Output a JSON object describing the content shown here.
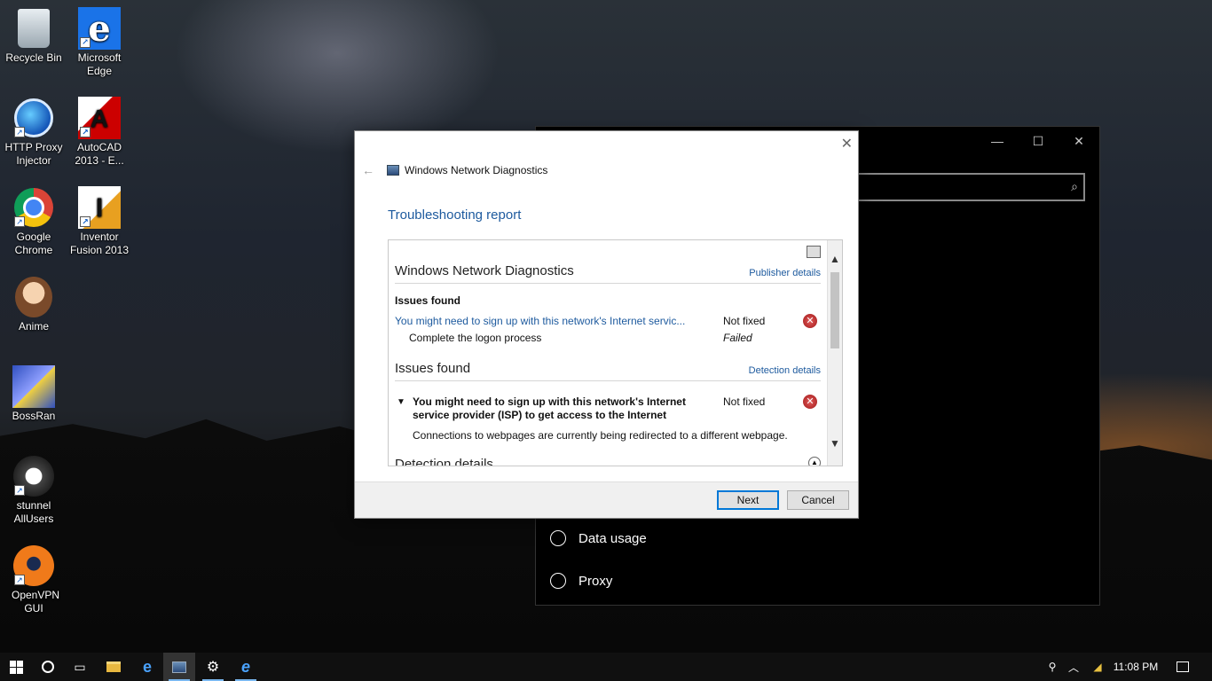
{
  "desktop": {
    "icons": [
      {
        "label": "Recycle Bin",
        "icon": "recycle-bin-icon"
      },
      {
        "label": "Microsoft Edge",
        "icon": "edge-icon"
      },
      {
        "label": "HTTP Proxy Injector",
        "icon": "http-proxy-injector-icon"
      },
      {
        "label": "AutoCAD 2013 - E...",
        "icon": "autocad-icon"
      },
      {
        "label": "Google Chrome",
        "icon": "chrome-icon"
      },
      {
        "label": "Inventor Fusion 2013",
        "icon": "inventor-icon"
      },
      {
        "label": "Anime",
        "icon": "anime-icon"
      },
      {
        "label": "BossRan",
        "icon": "bossran-icon"
      },
      {
        "label": "stunnel AllUsers",
        "icon": "stunnel-icon"
      },
      {
        "label": "OpenVPN GUI",
        "icon": "openvpn-icon"
      }
    ]
  },
  "settings_window": {
    "controls": {
      "minimize": "—",
      "maximize": "☐",
      "close": "✕"
    },
    "items": [
      {
        "label": "Data usage",
        "icon": "data-usage-icon"
      },
      {
        "label": "Proxy",
        "icon": "globe-icon"
      }
    ]
  },
  "dialog": {
    "title": "Windows Network Diagnostics",
    "heading": "Troubleshooting report",
    "report": {
      "section1_title": "Windows Network Diagnostics",
      "publisher_link": "Publisher details",
      "issues_found_label": "Issues found",
      "issue1_link": "You might need to sign up with this network's Internet servic...",
      "issue1_status": "Not fixed",
      "issue1_sub": "Complete the logon process",
      "issue1_sub_status": "Failed",
      "section2_title": "Issues found",
      "detection_link": "Detection details",
      "issue2_title": "You might need to sign up with this network's Internet service provider (ISP) to get access to the Internet",
      "issue2_status": "Not fixed",
      "issue2_desc": "Connections to webpages are currently being redirected to a different webpage.",
      "section3_partial": "Detection details"
    },
    "buttons": {
      "next": "Next",
      "cancel": "Cancel"
    }
  },
  "taskbar": {
    "clock": "11:08 PM",
    "pinned": [
      "start-icon",
      "cortana-icon",
      "task-view-icon",
      "file-explorer-icon",
      "edge-icon",
      "network-diagnostics-icon",
      "settings-gear-icon",
      "internet-explorer-icon"
    ]
  }
}
